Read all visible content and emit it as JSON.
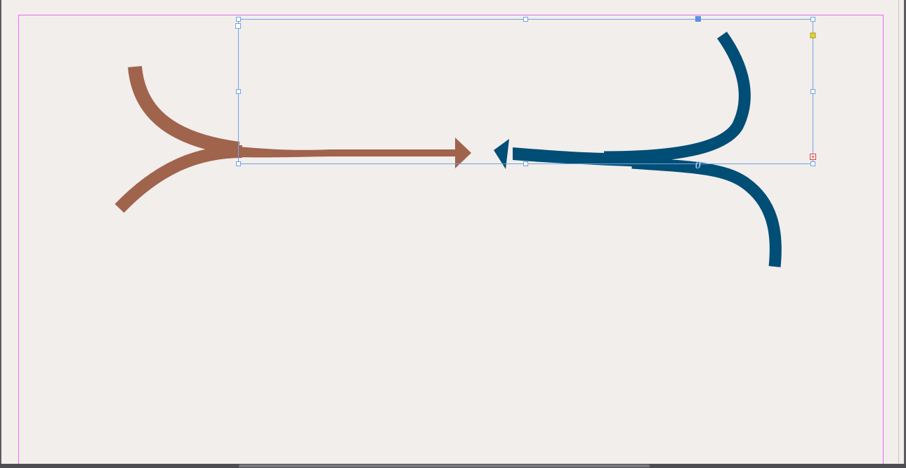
{
  "colors": {
    "pasteboard": "#f2eeec",
    "page_margin_guide": "#e36cf0",
    "frame_edge_selection": "#6fa3e8",
    "arrow_brown": "#a0634c",
    "arrow_blue": "#004e75",
    "handle_fill": "#ffffff",
    "handle_active": "#5b8fe8",
    "handle_corner_live": "#e2d22e",
    "handle_overset": "#e03a3a",
    "ui_chrome": "#4e4e52"
  },
  "icons": {
    "text_path_start_marker": "text-path-start-icon",
    "overset_marker": "overset-plus-icon",
    "live_corner_marker": "live-corner-icon"
  },
  "text_path_glyph": "0"
}
